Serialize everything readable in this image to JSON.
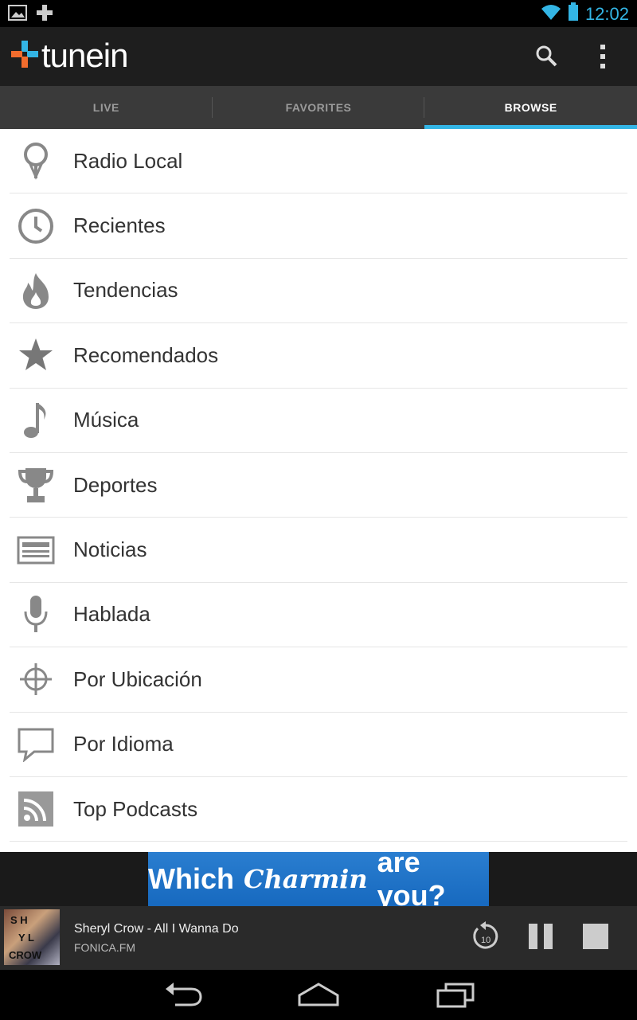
{
  "status_bar": {
    "time": "12:02"
  },
  "app": {
    "logo_text": "tunein"
  },
  "tabs": [
    {
      "label": "LIVE",
      "active": false
    },
    {
      "label": "FAVORITES",
      "active": false
    },
    {
      "label": "BROWSE",
      "active": true
    }
  ],
  "browse_items": [
    {
      "label": "Radio Local",
      "icon": "map-pin-icon"
    },
    {
      "label": "Recientes",
      "icon": "clock-icon"
    },
    {
      "label": "Tendencias",
      "icon": "flame-icon"
    },
    {
      "label": "Recomendados",
      "icon": "star-icon"
    },
    {
      "label": "Música",
      "icon": "music-note-icon"
    },
    {
      "label": "Deportes",
      "icon": "trophy-icon"
    },
    {
      "label": "Noticias",
      "icon": "newspaper-icon"
    },
    {
      "label": "Hablada",
      "icon": "microphone-icon"
    },
    {
      "label": "Por Ubicación",
      "icon": "crosshair-icon"
    },
    {
      "label": "Por Idioma",
      "icon": "speech-bubble-icon"
    },
    {
      "label": "Top Podcasts",
      "icon": "rss-icon"
    }
  ],
  "ad": {
    "text_before": "Which",
    "brand": "Charmin",
    "text_after": "are you?"
  },
  "now_playing": {
    "title": "Sheryl Crow - All I Wanna Do",
    "station": "FONICA.FM",
    "rewind_seconds": "10"
  },
  "colors": {
    "accent": "#33b5e5",
    "logo_orange": "#f26c2d",
    "logo_blue": "#33b5e5",
    "ad_blue": "#1e73c8"
  }
}
